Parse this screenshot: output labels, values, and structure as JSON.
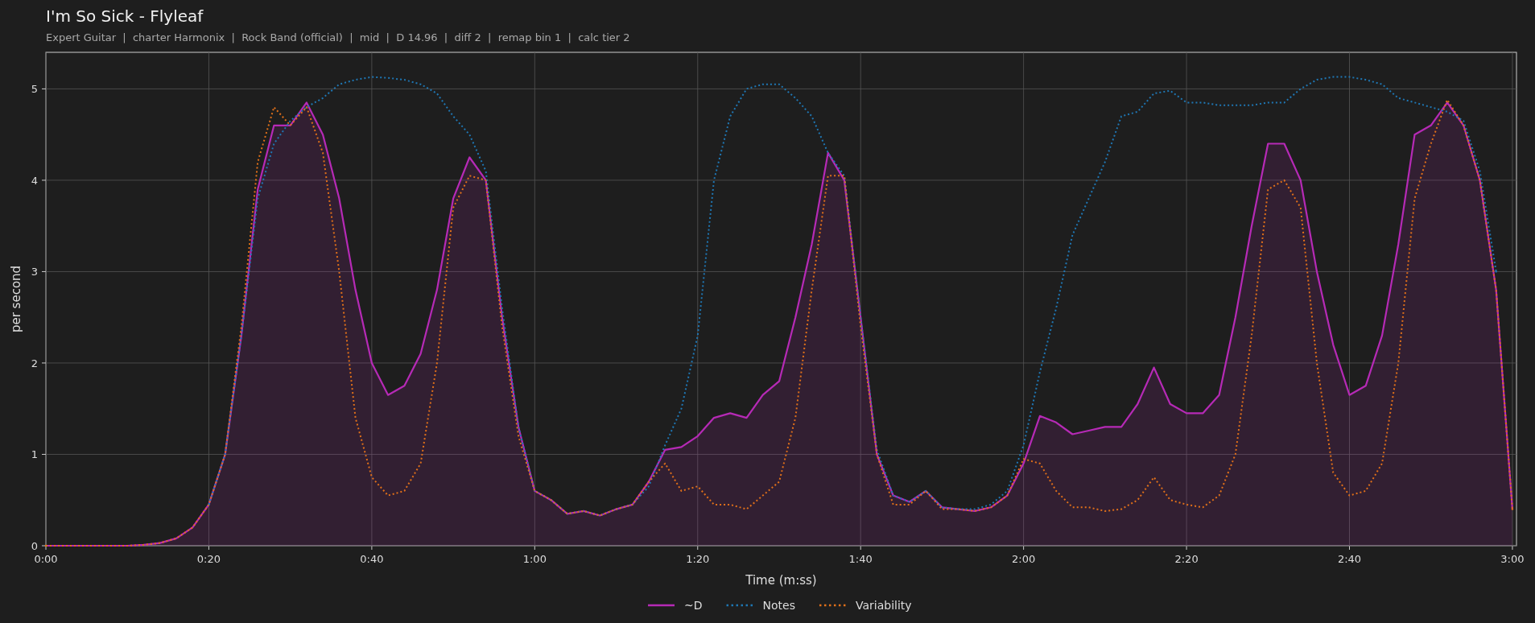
{
  "title": "I'm So Sick - Flyleaf",
  "subtitle": "Expert Guitar  |  charter Harmonix  |  Rock Band (official)  |  mid  |  D 14.96  |  diff 2  |  remap bin 1  |  calc tier 2",
  "chart": {
    "chart_data": {
      "type": "line",
      "xlabel": "Time (m:ss)",
      "ylabel": "per second",
      "x": [
        0,
        2,
        4,
        6,
        8,
        10,
        12,
        14,
        16,
        18,
        20,
        22,
        24,
        26,
        28,
        30,
        32,
        34,
        36,
        38,
        40,
        42,
        44,
        46,
        48,
        50,
        52,
        54,
        56,
        58,
        60,
        62,
        64,
        66,
        68,
        70,
        72,
        74,
        76,
        78,
        80,
        82,
        84,
        86,
        88,
        90,
        92,
        94,
        96,
        98,
        100,
        102,
        104,
        106,
        108,
        110,
        112,
        114,
        116,
        118,
        120,
        122,
        124,
        126,
        128,
        130,
        132,
        134,
        136,
        138,
        140,
        142,
        144,
        146,
        148,
        150,
        152,
        154,
        156,
        158,
        160,
        162,
        164,
        166,
        168,
        170,
        172,
        174,
        176,
        178,
        180
      ],
      "series": [
        {
          "name": "~D",
          "color": "#b62ab6",
          "line_style": "solid",
          "values": [
            0,
            0,
            0,
            0,
            0,
            0,
            0.01,
            0.03,
            0.08,
            0.2,
            0.45,
            1.0,
            2.3,
            3.9,
            4.6,
            4.6,
            4.85,
            4.5,
            3.8,
            2.8,
            2.0,
            1.65,
            1.75,
            2.1,
            2.8,
            3.8,
            4.25,
            4.0,
            2.5,
            1.3,
            0.6,
            0.5,
            0.35,
            0.38,
            0.33,
            0.4,
            0.45,
            0.7,
            1.05,
            1.08,
            1.2,
            1.4,
            1.45,
            1.4,
            1.65,
            1.8,
            2.5,
            3.3,
            4.3,
            4.0,
            2.5,
            1.0,
            0.55,
            0.48,
            0.6,
            0.42,
            0.4,
            0.38,
            0.42,
            0.55,
            0.9,
            1.42,
            1.35,
            1.22,
            1.26,
            1.3,
            1.3,
            1.55,
            1.95,
            1.55,
            1.45,
            1.45,
            1.65,
            2.5,
            3.5,
            4.4,
            4.4,
            4.0,
            3.0,
            2.2,
            1.65,
            1.75,
            2.3,
            3.3,
            4.5,
            4.6,
            4.85,
            4.6,
            4.0,
            2.8,
            0.4
          ]
        },
        {
          "name": "Notes",
          "color": "#1f77b4",
          "line_style": "dotted",
          "values": [
            null,
            null,
            null,
            null,
            null,
            null,
            null,
            null,
            null,
            null,
            0.45,
            1.0,
            2.3,
            3.8,
            4.4,
            4.65,
            4.8,
            4.9,
            5.05,
            5.1,
            5.13,
            5.12,
            5.1,
            5.05,
            4.95,
            4.7,
            4.5,
            4.1,
            2.6,
            1.3,
            0.6,
            0.5,
            0.35,
            0.38,
            0.33,
            0.4,
            0.45,
            0.65,
            1.1,
            1.5,
            2.3,
            4.0,
            4.7,
            5.0,
            5.05,
            5.05,
            4.9,
            4.7,
            4.3,
            4.05,
            2.5,
            1.05,
            0.55,
            0.48,
            0.6,
            0.42,
            0.4,
            0.4,
            0.45,
            0.6,
            1.1,
            1.9,
            2.6,
            3.4,
            3.8,
            4.2,
            4.7,
            4.75,
            4.95,
            4.98,
            4.85,
            4.85,
            4.82,
            4.82,
            4.82,
            4.85,
            4.85,
            5.0,
            5.1,
            5.13,
            5.13,
            5.1,
            5.05,
            4.9,
            4.85,
            4.8,
            4.75,
            4.65,
            4.1,
            3.0,
            null
          ]
        },
        {
          "name": "Variability",
          "color": "#e0701a",
          "line_style": "dotted",
          "values": [
            0,
            0,
            0,
            0,
            0,
            0,
            0.01,
            0.03,
            0.08,
            0.2,
            0.45,
            1.0,
            2.4,
            4.2,
            4.8,
            4.6,
            4.8,
            4.3,
            3.0,
            1.4,
            0.75,
            0.55,
            0.6,
            0.9,
            2.0,
            3.7,
            4.05,
            4.0,
            2.4,
            1.2,
            0.6,
            0.5,
            0.35,
            0.38,
            0.33,
            0.4,
            0.45,
            0.7,
            0.9,
            0.6,
            0.65,
            0.45,
            0.45,
            0.4,
            0.55,
            0.7,
            1.4,
            2.8,
            4.05,
            4.05,
            2.4,
            1.0,
            0.45,
            0.45,
            0.6,
            0.4,
            0.4,
            0.38,
            0.42,
            0.55,
            0.95,
            0.9,
            0.6,
            0.42,
            0.42,
            0.38,
            0.4,
            0.5,
            0.75,
            0.5,
            0.45,
            0.42,
            0.55,
            1.0,
            2.3,
            3.9,
            4.0,
            3.7,
            2.0,
            0.8,
            0.55,
            0.6,
            0.9,
            2.0,
            3.8,
            4.4,
            4.88,
            4.6,
            4.0,
            2.8,
            0.4
          ]
        }
      ],
      "grid": true,
      "legend": true,
      "xlim": [
        0,
        180.5
      ],
      "ylim": [
        0,
        5.4
      ],
      "xticks": [
        {
          "value": 0,
          "label": "0:00"
        },
        {
          "value": 20,
          "label": "0:20"
        },
        {
          "value": 40,
          "label": "0:40"
        },
        {
          "value": 60,
          "label": "1:00"
        },
        {
          "value": 80,
          "label": "1:20"
        },
        {
          "value": 100,
          "label": "1:40"
        },
        {
          "value": 120,
          "label": "2:00"
        },
        {
          "value": 140,
          "label": "2:20"
        },
        {
          "value": 160,
          "label": "2:40"
        },
        {
          "value": 180,
          "label": "3:00"
        }
      ],
      "yticks": [
        0,
        1,
        2,
        3,
        4,
        5
      ]
    }
  }
}
